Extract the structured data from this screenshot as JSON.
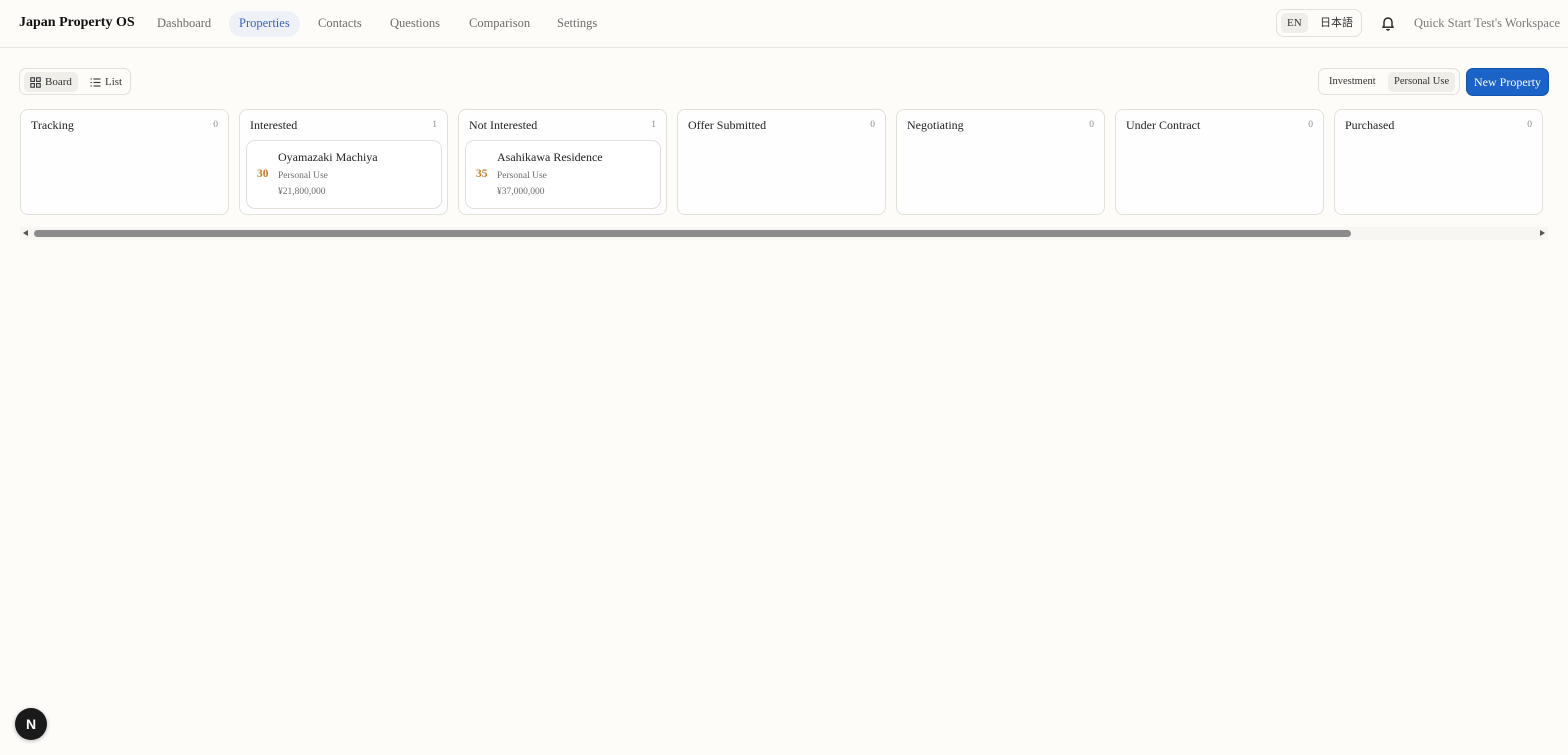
{
  "app": {
    "brand": "Japan Property OS",
    "nav": [
      "Dashboard",
      "Properties",
      "Contacts",
      "Questions",
      "Comparison",
      "Settings"
    ],
    "active_nav": "Properties",
    "lang": {
      "en": "EN",
      "ja": "日本語",
      "active": "EN"
    },
    "workspace": "Quick Start Test's Workspace"
  },
  "toolbar": {
    "board_label": "Board",
    "list_label": "List",
    "active_view": "Board",
    "filter_investment": "Investment",
    "filter_personal": "Personal Use",
    "new_property": "New Property"
  },
  "columns": [
    {
      "title": "Tracking",
      "count": "0",
      "cards": []
    },
    {
      "title": "Interested",
      "count": "1",
      "cards": [
        {
          "score": "30",
          "name": "Oyamazaki Machiya",
          "type": "Personal Use",
          "price": "¥21,800,000"
        }
      ]
    },
    {
      "title": "Not Interested",
      "count": "1",
      "cards": [
        {
          "score": "35",
          "name": "Asahikawa Residence",
          "type": "Personal Use",
          "price": "¥37,000,000"
        }
      ]
    },
    {
      "title": "Offer Submitted",
      "count": "0",
      "cards": []
    },
    {
      "title": "Negotiating",
      "count": "0",
      "cards": []
    },
    {
      "title": "Under Contract",
      "count": "0",
      "cards": []
    },
    {
      "title": "Purchased",
      "count": "0",
      "cards": []
    }
  ],
  "badge": "N",
  "colors": {
    "accent": "#1b63c6",
    "active_nav_text": "#3766b8",
    "score": "#c47a2a"
  }
}
